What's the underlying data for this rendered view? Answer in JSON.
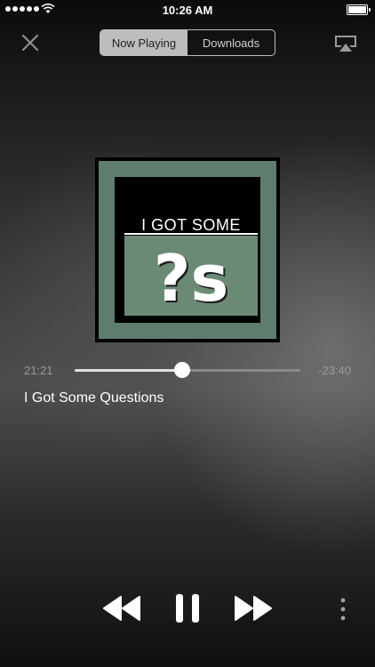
{
  "status_bar": {
    "time": "10:26 AM"
  },
  "nav": {
    "tabs": [
      {
        "label": "Now Playing",
        "active": true
      },
      {
        "label": "Downloads",
        "active": false
      }
    ]
  },
  "artwork": {
    "title": "I GOT SOME",
    "glyph": "?s"
  },
  "player": {
    "elapsed": "21:21",
    "remaining": "-23:40",
    "progress_fraction": 0.475,
    "song_title": "I Got Some Questions"
  }
}
